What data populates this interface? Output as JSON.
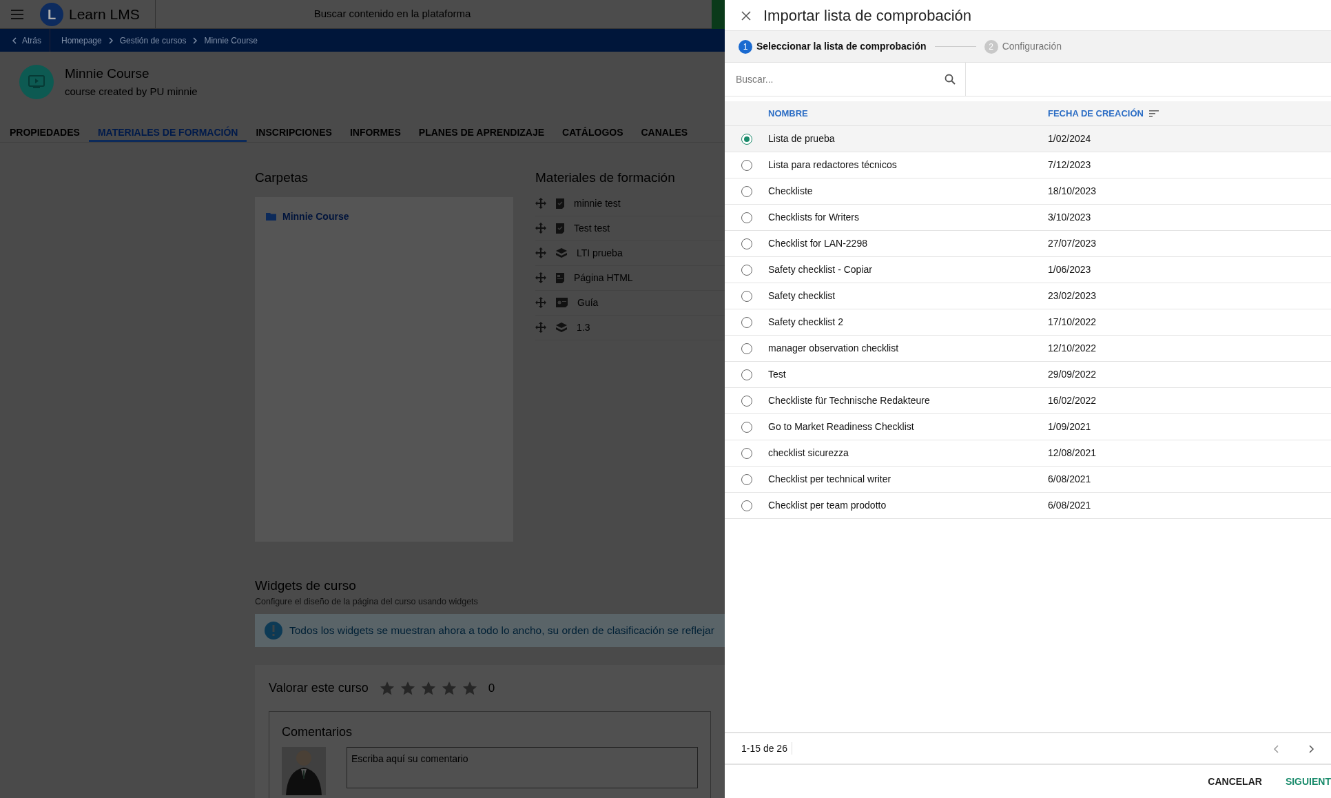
{
  "topbar": {
    "logo_letter": "L",
    "app_name": "Learn LMS",
    "search_placeholder": "Buscar contenido en la plataforma"
  },
  "breadcrumb": {
    "back": "Atrás",
    "items": [
      "Homepage",
      "Gestión de cursos",
      "Minnie Course"
    ]
  },
  "course": {
    "title": "Minnie Course",
    "subtitle": "course created by PU minnie"
  },
  "tabs": [
    {
      "label": "PROPIEDADES",
      "selected": false
    },
    {
      "label": "MATERIALES DE FORMACIÓN",
      "selected": true
    },
    {
      "label": "INSCRIPCIONES",
      "selected": false
    },
    {
      "label": "INFORMES",
      "selected": false
    },
    {
      "label": "PLANES DE APRENDIZAJE",
      "selected": false
    },
    {
      "label": "CATÁLOGOS",
      "selected": false
    },
    {
      "label": "CANALES",
      "selected": false
    }
  ],
  "folders": {
    "heading": "Carpetas",
    "items": [
      {
        "label": "Minnie Course"
      }
    ]
  },
  "materials": {
    "heading": "Materiales de formación",
    "items": [
      {
        "label": "minnie test",
        "kind": "checklist"
      },
      {
        "label": "Test test",
        "kind": "checklist"
      },
      {
        "label": "LTI prueba",
        "kind": "layers"
      },
      {
        "label": "Página HTML",
        "kind": "page"
      },
      {
        "label": "Guía",
        "kind": "guide"
      },
      {
        "label": "1.3",
        "kind": "layers"
      }
    ]
  },
  "widgets": {
    "heading": "Widgets de curso",
    "description": "Configure el diseño de la página del curso usando widgets",
    "alert": "Todos los widgets se muestran ahora a todo lo ancho, su orden de clasificación se reflejar"
  },
  "rating": {
    "label": "Valorar este curso",
    "stars": 0,
    "count": "0"
  },
  "comments": {
    "heading": "Comentarios",
    "placeholder": "Escriba aquí su comentario"
  },
  "dialog": {
    "title": "Importar lista de comprobación",
    "steps": [
      {
        "number": "1",
        "label": "Seleccionar la lista de comprobación",
        "active": true
      },
      {
        "number": "2",
        "label": "Configuración",
        "active": false
      }
    ],
    "search_placeholder": "Buscar...",
    "columns": [
      {
        "label": "NOMBRE",
        "sorted": false
      },
      {
        "label": "FECHA DE CREACIÓN",
        "sorted": true
      }
    ],
    "rows": [
      {
        "name": "Lista de prueba",
        "date": "1/02/2024",
        "selected": true
      },
      {
        "name": "Lista para redactores técnicos",
        "date": "7/12/2023",
        "selected": false
      },
      {
        "name": "Checkliste",
        "date": "18/10/2023",
        "selected": false
      },
      {
        "name": "Checklists for Writers",
        "date": "3/10/2023",
        "selected": false
      },
      {
        "name": "Checklist for LAN-2298",
        "date": "27/07/2023",
        "selected": false
      },
      {
        "name": "Safety checklist - Copiar",
        "date": "1/06/2023",
        "selected": false
      },
      {
        "name": "Safety checklist",
        "date": "23/02/2023",
        "selected": false
      },
      {
        "name": "Safety checklist 2",
        "date": "17/10/2022",
        "selected": false
      },
      {
        "name": "manager observation checklist",
        "date": "12/10/2022",
        "selected": false
      },
      {
        "name": "Test",
        "date": "29/09/2022",
        "selected": false
      },
      {
        "name": "Checkliste für Technische Redakteure",
        "date": "16/02/2022",
        "selected": false
      },
      {
        "name": "Go to Market Readiness Checklist",
        "date": "1/09/2021",
        "selected": false
      },
      {
        "name": "checklist sicurezza",
        "date": "12/08/2021",
        "selected": false
      },
      {
        "name": "Checklist per technical writer",
        "date": "6/08/2021",
        "selected": false
      },
      {
        "name": "Checklist per team prodotto",
        "date": "6/08/2021",
        "selected": false
      }
    ],
    "pagination": "1-15 de 26",
    "buttons": [
      {
        "label": "CANCELAR",
        "kind": "secondary"
      },
      {
        "label": "SIGUIENT",
        "kind": "primary"
      }
    ]
  }
}
